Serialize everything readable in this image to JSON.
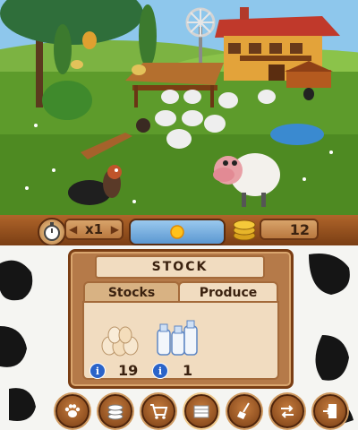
{
  "hud": {
    "speed": "x1",
    "coins": "12"
  },
  "stock_panel": {
    "title": "STOCK",
    "tabs": [
      {
        "label": "Stocks"
      },
      {
        "label": "Produce"
      }
    ],
    "items": [
      {
        "icon": "eggs-icon",
        "count": "19"
      },
      {
        "icon": "milk-bottles-icon",
        "count": "1"
      }
    ]
  },
  "toolbar": {
    "buttons": [
      {
        "icon": "paw-icon"
      },
      {
        "icon": "coins-stack-icon"
      },
      {
        "icon": "shopping-cart-icon"
      },
      {
        "icon": "crate-icon"
      },
      {
        "icon": "broom-icon"
      },
      {
        "icon": "swap-arrows-icon"
      },
      {
        "icon": "exit-door-icon"
      }
    ]
  },
  "colors": {
    "sky": "#8ec7ec",
    "grass": "#5d9b2b",
    "wood": "#7a3e14",
    "panel": "#b57a49",
    "info_blue": "#2a63c9"
  }
}
